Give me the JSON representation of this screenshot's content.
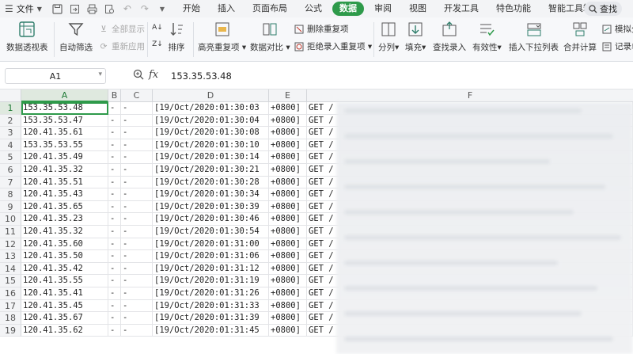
{
  "menubar": {
    "file_label": "文件",
    "tabs": [
      {
        "label": "开始",
        "active": false
      },
      {
        "label": "插入",
        "active": false
      },
      {
        "label": "页面布局",
        "active": false
      },
      {
        "label": "公式",
        "active": false
      },
      {
        "label": "数据",
        "active": true
      },
      {
        "label": "审阅",
        "active": false
      },
      {
        "label": "视图",
        "active": false
      },
      {
        "label": "开发工具",
        "active": false
      },
      {
        "label": "特色功能",
        "active": false
      },
      {
        "label": "智能工具箱",
        "active": false
      }
    ],
    "search_label": "查找"
  },
  "ribbon": {
    "pivot": "数据透视表",
    "autofilter": "自动筛选",
    "show_all": "全部显示",
    "reapply": "重新应用",
    "sort": "排序",
    "highlight_dup": "高亮重复项",
    "data_compare": "数据对比",
    "remove_dup": "删除重复项",
    "reject_dup": "拒绝录入重复项",
    "split": "分列",
    "fill": "填充",
    "lookup_entry": "查找录入",
    "validity": "有效性",
    "insert_dropdown": "插入下拉列表",
    "consolidate": "合并计算",
    "simulate": "模拟分",
    "record": "记录单"
  },
  "formula_bar": {
    "cell_ref": "A1",
    "fx_label": "fx",
    "value": "153.35.53.48"
  },
  "grid": {
    "columns": [
      "A",
      "B",
      "C",
      "D",
      "E",
      "F"
    ],
    "rows": [
      {
        "n": "1",
        "a": "153.35.53.48",
        "b": "-",
        "c": "-",
        "d": "[19/Oct/2020:01:30:03",
        "e": "+0800]",
        "f": "GET /"
      },
      {
        "n": "2",
        "a": "153.35.53.47",
        "b": "-",
        "c": "-",
        "d": "[19/Oct/2020:01:30:04",
        "e": "+0800]",
        "f": "GET /"
      },
      {
        "n": "3",
        "a": "120.41.35.61",
        "b": "-",
        "c": "-",
        "d": "[19/Oct/2020:01:30:08",
        "e": "+0800]",
        "f": "GET /"
      },
      {
        "n": "4",
        "a": "153.35.53.55",
        "b": "-",
        "c": "-",
        "d": "[19/Oct/2020:01:30:10",
        "e": "+0800]",
        "f": "GET /"
      },
      {
        "n": "5",
        "a": "120.41.35.49",
        "b": "-",
        "c": "-",
        "d": "[19/Oct/2020:01:30:14",
        "e": "+0800]",
        "f": "GET /"
      },
      {
        "n": "6",
        "a": "120.41.35.32",
        "b": "-",
        "c": "-",
        "d": "[19/Oct/2020:01:30:21",
        "e": "+0800]",
        "f": "GET /"
      },
      {
        "n": "7",
        "a": "120.41.35.51",
        "b": "-",
        "c": "-",
        "d": "[19/Oct/2020:01:30:28",
        "e": "+0800]",
        "f": "GET /"
      },
      {
        "n": "8",
        "a": "120.41.35.43",
        "b": "-",
        "c": "-",
        "d": "[19/Oct/2020:01:30:34",
        "e": "+0800]",
        "f": "GET /"
      },
      {
        "n": "9",
        "a": "120.41.35.65",
        "b": "-",
        "c": "-",
        "d": "[19/Oct/2020:01:30:39",
        "e": "+0800]",
        "f": "GET /"
      },
      {
        "n": "10",
        "a": "120.41.35.23",
        "b": "-",
        "c": "-",
        "d": "[19/Oct/2020:01:30:46",
        "e": "+0800]",
        "f": "GET /"
      },
      {
        "n": "11",
        "a": "120.41.35.32",
        "b": "-",
        "c": "-",
        "d": "[19/Oct/2020:01:30:54",
        "e": "+0800]",
        "f": "GET /"
      },
      {
        "n": "12",
        "a": "120.41.35.60",
        "b": "-",
        "c": "-",
        "d": "[19/Oct/2020:01:31:00",
        "e": "+0800]",
        "f": "GET /"
      },
      {
        "n": "13",
        "a": "120.41.35.50",
        "b": "-",
        "c": "-",
        "d": "[19/Oct/2020:01:31:06",
        "e": "+0800]",
        "f": "GET /"
      },
      {
        "n": "14",
        "a": "120.41.35.42",
        "b": "-",
        "c": "-",
        "d": "[19/Oct/2020:01:31:12",
        "e": "+0800]",
        "f": "GET /"
      },
      {
        "n": "15",
        "a": "120.41.35.55",
        "b": "-",
        "c": "-",
        "d": "[19/Oct/2020:01:31:19",
        "e": "+0800]",
        "f": "GET /"
      },
      {
        "n": "16",
        "a": "120.41.35.41",
        "b": "-",
        "c": "-",
        "d": "[19/Oct/2020:01:31:26",
        "e": "+0800]",
        "f": "GET /"
      },
      {
        "n": "17",
        "a": "120.41.35.45",
        "b": "-",
        "c": "-",
        "d": "[19/Oct/2020:01:31:33",
        "e": "+0800]",
        "f": "GET /"
      },
      {
        "n": "18",
        "a": "120.41.35.67",
        "b": "-",
        "c": "-",
        "d": "[19/Oct/2020:01:31:39",
        "e": "+0800]",
        "f": "GET /"
      },
      {
        "n": "19",
        "a": "120.41.35.62",
        "b": "-",
        "c": "-",
        "d": "[19/Oct/2020:01:31:45",
        "e": "+0800]",
        "f": "GET /"
      }
    ]
  },
  "colors": {
    "accent": "#2e9a4a",
    "selection_fill": "#dfe9df"
  }
}
